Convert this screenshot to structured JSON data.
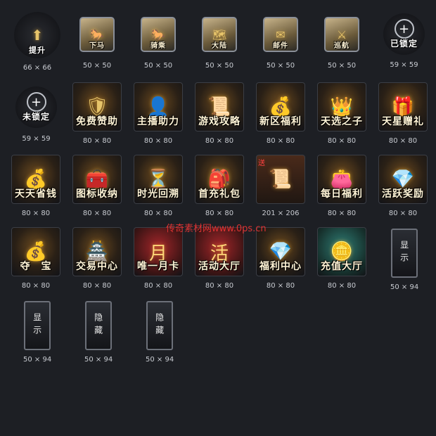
{
  "watermark": "传奇素材网www.0ps.cn",
  "icons": [
    {
      "label": "提升",
      "size": "66 × 66",
      "glyph": "⬆"
    },
    {
      "label": "下马",
      "size": "50 × 50",
      "glyph": "🐎"
    },
    {
      "label": "骑乘",
      "size": "50 × 50",
      "glyph": "🐎"
    },
    {
      "label": "大陆",
      "size": "50 × 50",
      "glyph": "🗺"
    },
    {
      "label": "邮件",
      "size": "50 × 50",
      "glyph": "✉"
    },
    {
      "label": "巡航",
      "size": "50 × 50",
      "glyph": "⚔"
    },
    {
      "label": "已锁定",
      "size": "59 × 59",
      "glyph": "+"
    },
    {
      "label": "未锁定",
      "size": "59 × 59",
      "glyph": "+"
    },
    {
      "label": "免费赞助",
      "size": "80 × 80",
      "glyph": "🛡"
    },
    {
      "label": "主播助力",
      "size": "80 × 80",
      "glyph": "👤"
    },
    {
      "label": "游戏攻略",
      "size": "80 × 80",
      "glyph": "📜"
    },
    {
      "label": "新区福利",
      "size": "80 × 80",
      "glyph": "💰"
    },
    {
      "label": "天选之子",
      "size": "80 × 80",
      "glyph": "👑"
    },
    {
      "label": "天星赠礼",
      "size": "80 × 80",
      "glyph": "🎁"
    },
    {
      "label": "天天省钱",
      "size": "80 × 80",
      "glyph": "💰"
    },
    {
      "label": "图标收纳",
      "size": "80 × 80",
      "glyph": "🧰"
    },
    {
      "label": "时光回溯",
      "size": "80 × 80",
      "glyph": "⏳"
    },
    {
      "label": "首充礼包",
      "size": "80 × 80",
      "glyph": "🎒"
    },
    {
      "label": "",
      "size": "201 × 206",
      "glyph": "📜",
      "ribbon": "送"
    },
    {
      "label": "每日福利",
      "size": "80 × 80",
      "glyph": "👛"
    },
    {
      "label": "活跃奖励",
      "size": "80 × 80",
      "glyph": "💎"
    },
    {
      "label": "夺　宝",
      "size": "80 × 80",
      "glyph": "💰"
    },
    {
      "label": "交易中心",
      "size": "80 × 80",
      "glyph": "🏯"
    },
    {
      "label": "唯一月卡",
      "size": "80 × 80",
      "glyph": "月"
    },
    {
      "label": "活动大厅",
      "size": "80 × 80",
      "glyph": "活"
    },
    {
      "label": "福利中心",
      "size": "80 × 80",
      "glyph": "💎"
    },
    {
      "label": "充值大厅",
      "size": "80 × 80",
      "glyph": "🪙"
    },
    {
      "label": "显示",
      "size": "50 × 94",
      "glyph": ""
    },
    {
      "label": "显示",
      "size": "50 × 94",
      "glyph": ""
    },
    {
      "label": "隐藏",
      "size": "50 × 94",
      "glyph": ""
    },
    {
      "label": "隐藏",
      "size": "50 × 94",
      "glyph": ""
    }
  ]
}
